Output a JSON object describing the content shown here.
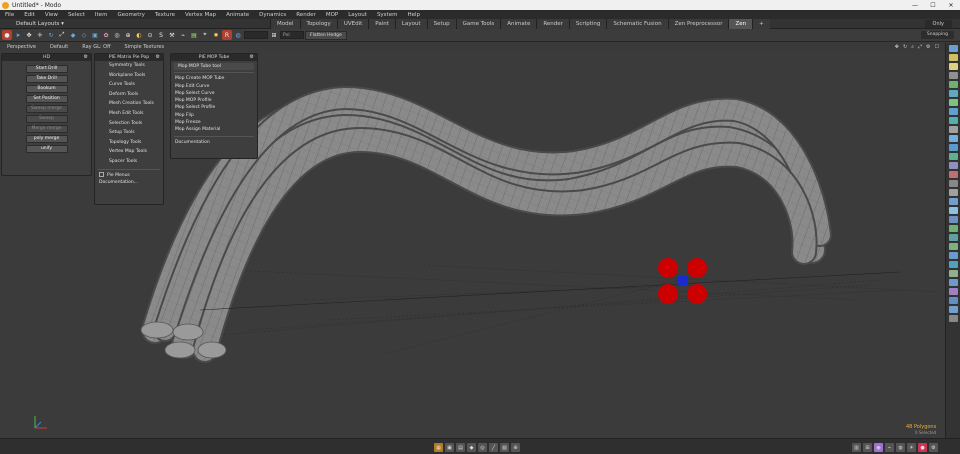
{
  "window": {
    "title": "Untitled* - Modo",
    "controls": [
      "—",
      "☐",
      "✕"
    ]
  },
  "menu": {
    "items": [
      "File",
      "Edit",
      "View",
      "Select",
      "Item",
      "Geometry",
      "Texture",
      "Vertex Map",
      "Animate",
      "Dynamics",
      "Render",
      "MOP",
      "Layout",
      "System",
      "Help"
    ]
  },
  "layout": {
    "dropdown": "Default Layouts ▾",
    "tabs": [
      "Model",
      "Topology",
      "UVEdit",
      "Paint",
      "Layout",
      "Setup",
      "Game Tools",
      "Animate",
      "Render",
      "Scripting",
      "Schematic Fusion",
      "Zen Preprocessor",
      "Zen"
    ],
    "active_tab": "Zen",
    "add": "+",
    "only": "Only"
  },
  "toolbar": {
    "field1": "",
    "field2": "Pxl",
    "button": "Flatten Hedge",
    "snapping": "Snapping"
  },
  "viewport_header": {
    "items": [
      "Perspective",
      "Default",
      "Ray GL: Off",
      "Simple Textures"
    ]
  },
  "panels": {
    "hd": {
      "title": "HD",
      "buttons": [
        {
          "label": "Start Drill",
          "enabled": true
        },
        {
          "label": "Take Drill",
          "enabled": true
        },
        {
          "label": "Bookum",
          "enabled": true
        },
        {
          "label": "Set Position",
          "enabled": true
        },
        {
          "label": "Sweep merge",
          "enabled": false
        },
        {
          "label": "Sweep",
          "enabled": false
        },
        {
          "label": "Merge merge",
          "enabled": false
        },
        {
          "label": "poly merge",
          "enabled": true
        },
        {
          "label": "unify",
          "enabled": true
        }
      ]
    },
    "pie": {
      "title": "PIE Matrix Pie Pop",
      "items": [
        "Symmetry Tools",
        "Workplane Tools",
        "Curve Tools",
        "Deform Tools",
        "Mesh Creation Tools",
        "Mesh Edit Tools",
        "Selection Tools",
        "Setup Tools",
        "Topology Tools",
        "Vertex Map Tools",
        "Spacer Tools"
      ],
      "checkbox_label": "Pie Menus",
      "doc_label": "Documentation..."
    },
    "mop": {
      "title": "PIE MOP Tube",
      "header_item": "Mop MOP Tube tool",
      "items": [
        "Mop Create MOP Tube",
        "Mop Edit Curve",
        "Mop Select Curve",
        "Mop MOP Profile",
        "Mop Select Profile",
        "Mop Flip",
        "Mop Freeze",
        "Mop Assign Material"
      ],
      "doc_label": "Documentation"
    }
  },
  "status": {
    "polycount": "48 Polygons",
    "subtext": "0 Selected"
  },
  "icons": {
    "app": "modo-logo-icon",
    "rightbar": [
      "item-icon",
      "mesh-icon",
      "light-icon",
      "camera-icon"
    ],
    "bottombar": [
      "shading-icon",
      "wireframe-icon",
      "texture-icon",
      "vertex-icon",
      "edge-icon",
      "polygon-icon",
      "item-mode-icon",
      "pivot-icon"
    ]
  },
  "colors": {
    "accent": "#f0a020",
    "handle_red": "#cc0000",
    "handle_center": "#1a2acc",
    "active_tab": "#555555"
  }
}
